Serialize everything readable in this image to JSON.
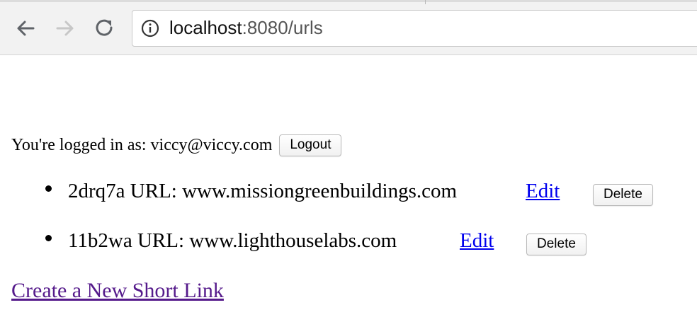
{
  "browser": {
    "url_host": "localhost",
    "url_rest": ":8080/urls"
  },
  "page": {
    "login_text": "You're logged in as: viccy@viccy.com",
    "logout_label": "Logout",
    "urls": [
      {
        "text": "2drq7a URL: www.missiongreenbuildings.com",
        "edit_label": "Edit",
        "delete_label": "Delete"
      },
      {
        "text": "11b2wa URL: www.lighthouselabs.com",
        "edit_label": "Edit",
        "delete_label": "Delete"
      }
    ],
    "create_link": "Create a New Short Link"
  },
  "colors": {
    "link_unvisited": "#0000ee",
    "link_visited": "#551a8b"
  }
}
